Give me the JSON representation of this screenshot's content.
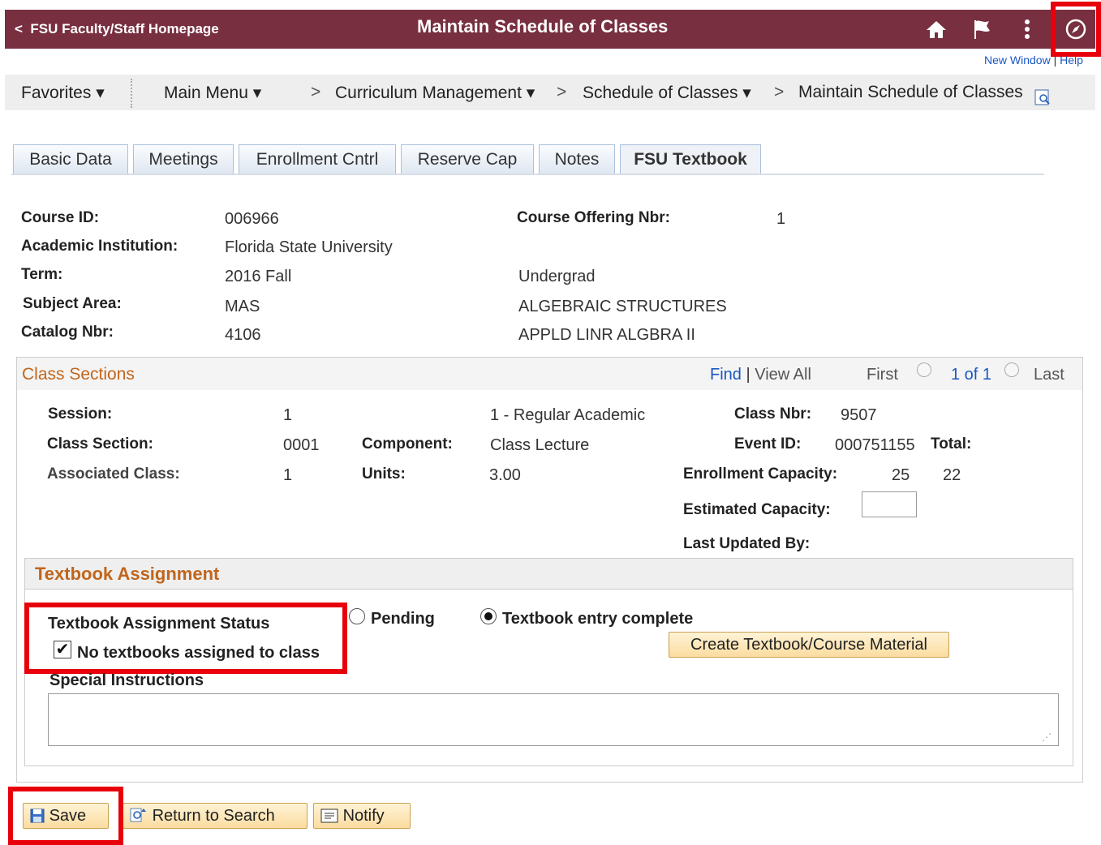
{
  "header": {
    "back_label": "FSU Faculty/Staff Homepage",
    "title": "Maintain Schedule of Classes",
    "icons": [
      "home-icon",
      "flag-icon",
      "more-vertical-icon",
      "navbar-compass-icon"
    ],
    "new_window": "New Window",
    "separator": "|",
    "help": "Help"
  },
  "nav": {
    "favorites": "Favorites ▾",
    "main_menu": "Main Menu ▾",
    "sep": ">",
    "curriculum": "Curriculum Management ▾",
    "schedule": "Schedule of Classes ▾",
    "maintain": "Maintain Schedule of Classes"
  },
  "tabs": [
    {
      "label": "Basic Data"
    },
    {
      "label": "Meetings"
    },
    {
      "label": "Enrollment Cntrl"
    },
    {
      "label": "Reserve Cap"
    },
    {
      "label": "Notes"
    },
    {
      "label": "FSU Textbook"
    }
  ],
  "course": {
    "course_id_label": "Course ID:",
    "course_id": "006966",
    "offering_label": "Course Offering Nbr:",
    "offering": "1",
    "institution_label": "Academic Institution:",
    "institution": "Florida State University",
    "term_label": "Term:",
    "term": "2016 Fall",
    "career": "Undergrad",
    "subject_label": "Subject Area:",
    "subject": "MAS",
    "subject_desc": "ALGEBRAIC STRUCTURES",
    "catalog_label": "Catalog Nbr:",
    "catalog": "4106",
    "catalog_desc": "APPLD LINR ALGBRA II"
  },
  "sections": {
    "title": "Class Sections",
    "find": "Find",
    "pipe": "|",
    "view_all": "View All",
    "first": "First",
    "pager": "1 of 1",
    "last": "Last",
    "session_label": "Session:",
    "session": "1",
    "session_desc": "1 - Regular Academic",
    "class_nbr_label": "Class Nbr:",
    "class_nbr": "9507",
    "section_label": "Class Section:",
    "section": "0001",
    "component_label": "Component:",
    "component": "Class Lecture",
    "event_label": "Event ID:",
    "event": "000751155",
    "total_label": "Total:",
    "assoc_label": "Associated Class:",
    "assoc": "1",
    "units_label": "Units:",
    "units": "3.00",
    "enroll_cap_label": "Enrollment Capacity:",
    "enroll_cap": "25",
    "total": "22",
    "est_cap_label": "Estimated Capacity:",
    "est_cap": "",
    "last_updated_label": "Last Updated By:"
  },
  "textbook": {
    "title": "Textbook Assignment",
    "status_label": "Textbook Assignment Status",
    "pending": "Pending",
    "complete": "Textbook entry complete",
    "selected": "complete",
    "no_textbooks": "No textbooks assigned to class",
    "no_textbooks_checked": true,
    "create_button": "Create Textbook/Course Material",
    "special_label": "Special Instructions",
    "special_value": ""
  },
  "footer": {
    "save": "Save",
    "return": "Return to Search",
    "notify": "Notify"
  },
  "colors": {
    "header_bg": "#782f40",
    "accent_orange": "#c0661c",
    "link_blue": "#1a57c2",
    "highlight_red": "#e8000b"
  }
}
